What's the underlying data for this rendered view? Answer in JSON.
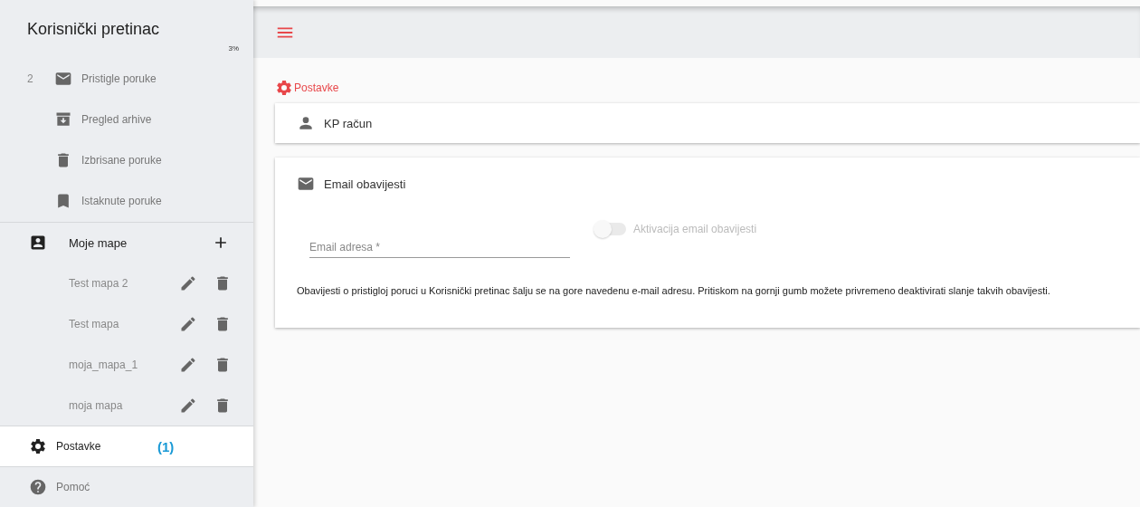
{
  "sidebar": {
    "title": "Korisnički pretinac",
    "usage": "3%",
    "mail_items": [
      {
        "count": "2",
        "label": "Pristigle poruke"
      },
      {
        "label": "Pregled arhive"
      },
      {
        "label": "Izbrisane poruke"
      },
      {
        "label": "Istaknute poruke"
      }
    ],
    "folders_header": "Moje mape",
    "folders": [
      {
        "label": "Test mapa 2"
      },
      {
        "label": "Test mapa"
      },
      {
        "label": "moja_mapa_1"
      },
      {
        "label": "moja mapa"
      }
    ],
    "bottom_items": [
      {
        "label": "Postavke",
        "badge": "(1)",
        "selected": true
      },
      {
        "label": "Pomoć",
        "selected": false
      }
    ]
  },
  "breadcrumb": "Postavke",
  "account_panel": {
    "title": "KP račun"
  },
  "email_panel": {
    "title": "Email obavijesti",
    "email_field": {
      "placeholder": "Email adresa *"
    },
    "toggle": {
      "label": "Aktivacija email obavijesti",
      "on": false,
      "disabled": true
    },
    "note": "Obavijesti o pristigloj poruci u Korisnički pretinac šalju se na gore navedenu e-mail adresu. Pritiskom na gornji gumb možete privremeno deaktivirati slanje takvih obavijesti."
  }
}
